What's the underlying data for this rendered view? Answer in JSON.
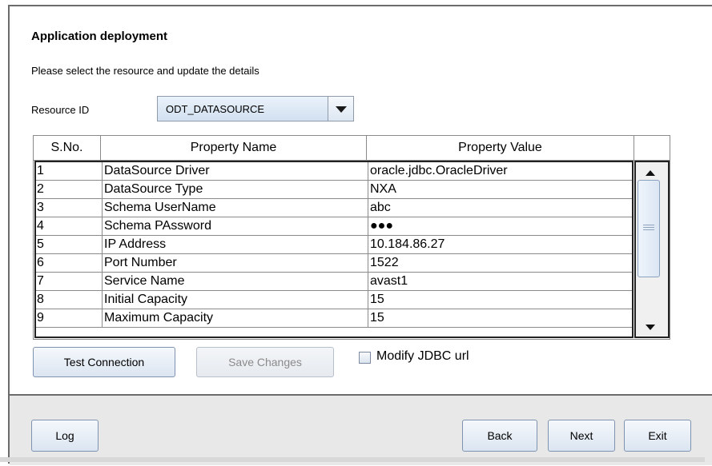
{
  "header": {
    "title": "Application deployment",
    "subtitle": "Please select the resource and update the details"
  },
  "resource": {
    "label": "Resource ID",
    "selected": "ODT_DATASOURCE"
  },
  "table": {
    "columns": [
      "S.No.",
      "Property Name",
      "Property Value"
    ],
    "rows": [
      {
        "sno": "1",
        "name": "DataSource Driver",
        "value": "oracle.jdbc.OracleDriver"
      },
      {
        "sno": "2",
        "name": "DataSource Type",
        "value": "NXA"
      },
      {
        "sno": "3",
        "name": "Schema UserName",
        "value": "abc"
      },
      {
        "sno": "4",
        "name": "Schema PAssword",
        "value": "●●●"
      },
      {
        "sno": "5",
        "name": "IP Address",
        "value": "10.184.86.27"
      },
      {
        "sno": "6",
        "name": "Port Number",
        "value": "1522"
      },
      {
        "sno": "7",
        "name": "Service Name",
        "value": "avast1"
      },
      {
        "sno": "8",
        "name": "Initial Capacity",
        "value": "15"
      },
      {
        "sno": "9",
        "name": "Maximum Capacity",
        "value": "15"
      }
    ]
  },
  "actions": {
    "test_connection": "Test Connection",
    "save_changes": "Save Changes",
    "modify_jdbc": "Modify JDBC url"
  },
  "footer": {
    "log": "Log",
    "back": "Back",
    "next": "Next",
    "exit": "Exit"
  }
}
